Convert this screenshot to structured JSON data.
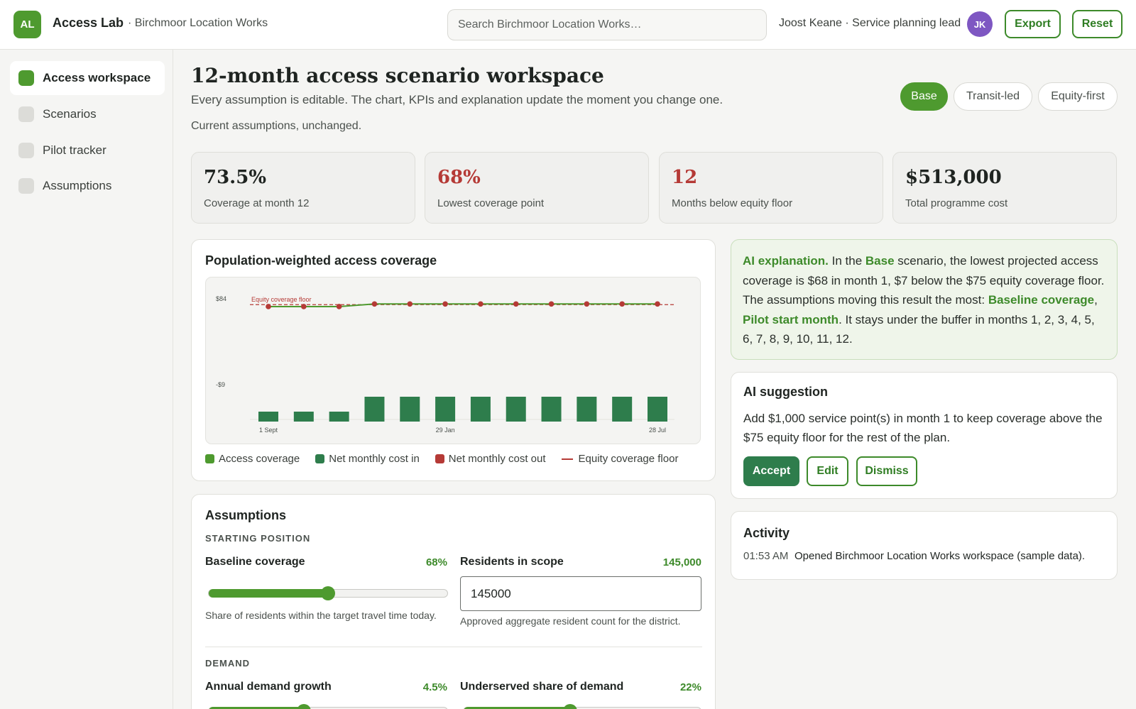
{
  "app": {
    "logo_initials": "AL",
    "name": "Access Lab",
    "org": "· Birchmoor Location Works",
    "search_placeholder": "Search Birchmoor Location Works…",
    "user": "Joost Keane · Service planning lead",
    "user_initials": "JK",
    "export_label": "Export",
    "reset_label": "Reset"
  },
  "sidebar": {
    "items": [
      {
        "label": "Access workspace"
      },
      {
        "label": "Scenarios"
      },
      {
        "label": "Pilot tracker"
      },
      {
        "label": "Assumptions"
      }
    ]
  },
  "header": {
    "title": "12-month access scenario workspace",
    "subtitle": "Every assumption is editable. The chart, KPIs and explanation update the moment you change one.",
    "status": "Current assumptions, unchanged.",
    "scenarios": [
      "Base",
      "Transit-led",
      "Equity-first"
    ],
    "active_scenario": "Base"
  },
  "kpis": [
    {
      "value": "73.5%",
      "label": "Coverage at month 12"
    },
    {
      "value": "68%",
      "label": "Lowest coverage point"
    },
    {
      "value": "12",
      "label": "Months below equity floor"
    },
    {
      "value": "$513,000",
      "label": "Total programme cost"
    }
  ],
  "chart_card": {
    "title": "Population-weighted access coverage"
  },
  "chart_data": {
    "type": "line",
    "y_tick_labels": [
      "$84",
      "-$9"
    ],
    "x_tick_labels": [
      "1 Sept",
      "29 Jan",
      "28 Jul"
    ],
    "ylim": [
      -9,
      84
    ],
    "reference_line": {
      "label": "Equity coverage floor",
      "value": 79.5
    },
    "series": [
      {
        "name": "Access coverage",
        "type": "line",
        "values": [
          78,
          78,
          78,
          80,
          80,
          80,
          80,
          80,
          80,
          80,
          80,
          80
        ]
      },
      {
        "name": "Net monthly cost in",
        "type": "bar",
        "values": [
          -3.5,
          -3.5,
          -3.5,
          0.5,
          0.5,
          0.5,
          0.5,
          0.5,
          0.5,
          0.5,
          0.5,
          0.5
        ]
      }
    ],
    "legend": [
      {
        "name": "Access coverage",
        "color": "#4e9a2f",
        "kind": "square"
      },
      {
        "name": "Net monthly cost in",
        "color": "#2e7d4c",
        "kind": "square"
      },
      {
        "name": "Net monthly cost out",
        "color": "#b53a36",
        "kind": "square"
      },
      {
        "name": "Equity coverage floor",
        "color": "#b53a36",
        "kind": "line"
      }
    ]
  },
  "ai_explanation": {
    "lead": "AI explanation.",
    "t1": " In the ",
    "scenario": "Base",
    "t2": " scenario, the lowest projected access coverage is $68 in month 1, $7 below the $75 equity coverage floor. The assumptions moving this result the most: ",
    "driver1": "Baseline coverage",
    "t3": ", ",
    "driver2": "Pilot start month",
    "t4": ". It stays under the buffer in months 1, 2, 3, 4, 5, 6, 7, 8, 9, 10, 11, 12."
  },
  "ai_suggestion": {
    "title": "AI suggestion",
    "text": "Add $1,000 service point(s) in month 1 to keep coverage above the $75 equity floor for the rest of the plan.",
    "accept_label": "Accept",
    "edit_label": "Edit",
    "dismiss_label": "Dismiss"
  },
  "activity": {
    "title": "Activity",
    "items": [
      {
        "time": "01:53 AM",
        "text": "Opened Birchmoor Location Works workspace (sample data)."
      }
    ]
  },
  "assumptions": {
    "title": "Assumptions",
    "sections": [
      {
        "label": "STARTING POSITION"
      },
      {
        "label": "DEMAND"
      }
    ],
    "baseline_coverage": {
      "label": "Baseline coverage",
      "value": "68%",
      "fraction": 0.5,
      "help": "Share of residents within the target travel time today."
    },
    "residents": {
      "label": "Residents in scope",
      "value": "145,000",
      "input_value": "145000",
      "help": "Approved aggregate resident count for the district."
    },
    "demand_growth": {
      "label": "Annual demand growth",
      "value": "4.5%",
      "fraction": 0.4
    },
    "underserved": {
      "label": "Underserved share of demand",
      "value": "22%",
      "fraction": 0.45
    }
  },
  "colors": {
    "brand": "#4e9a2f",
    "dark_green": "#2e7d4c",
    "red": "#b53a36",
    "avatar": "#7e57c2"
  }
}
